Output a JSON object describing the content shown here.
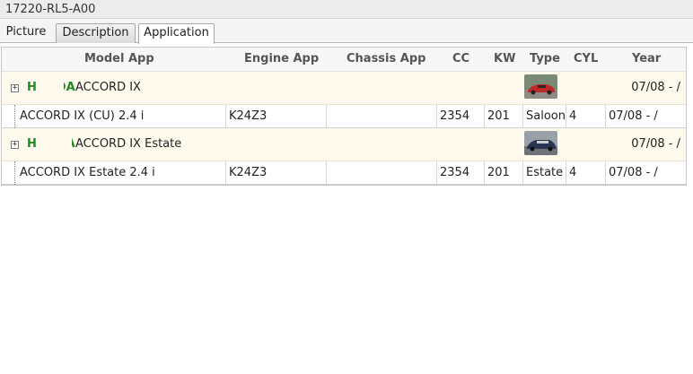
{
  "window": {
    "title": "17220-RL5-A00"
  },
  "tabs": [
    {
      "label": "Picture"
    },
    {
      "label": "Description"
    },
    {
      "label": "Application"
    }
  ],
  "grid": {
    "columns": [
      "Model App",
      "Engine App",
      "Chassis App",
      "CC",
      "KW",
      "Type",
      "CYL",
      "Year"
    ],
    "groups": [
      {
        "expander": "+",
        "brand": "HONDA",
        "title": "ACCORD IX",
        "year": "07/08 - /",
        "thumb_color": "#c0282a",
        "rows": [
          {
            "model": "ACCORD IX (CU) 2.4 i",
            "engine": "K24Z3",
            "chassis": "",
            "cc": "2354",
            "kw": "201",
            "type": "Saloon",
            "cyl": "4",
            "year": "07/08 - /"
          }
        ]
      },
      {
        "expander": "+",
        "brand": "HONDA",
        "title": "ACCORD IX Estate",
        "year": "07/08 - /",
        "thumb_color": "#2a3550",
        "rows": [
          {
            "model": "ACCORD IX Estate 2.4 i",
            "engine": "K24Z3",
            "chassis": "",
            "cc": "2354",
            "kw": "201",
            "type": "Estate",
            "cyl": "4",
            "year": "07/08 - /"
          }
        ]
      }
    ]
  }
}
